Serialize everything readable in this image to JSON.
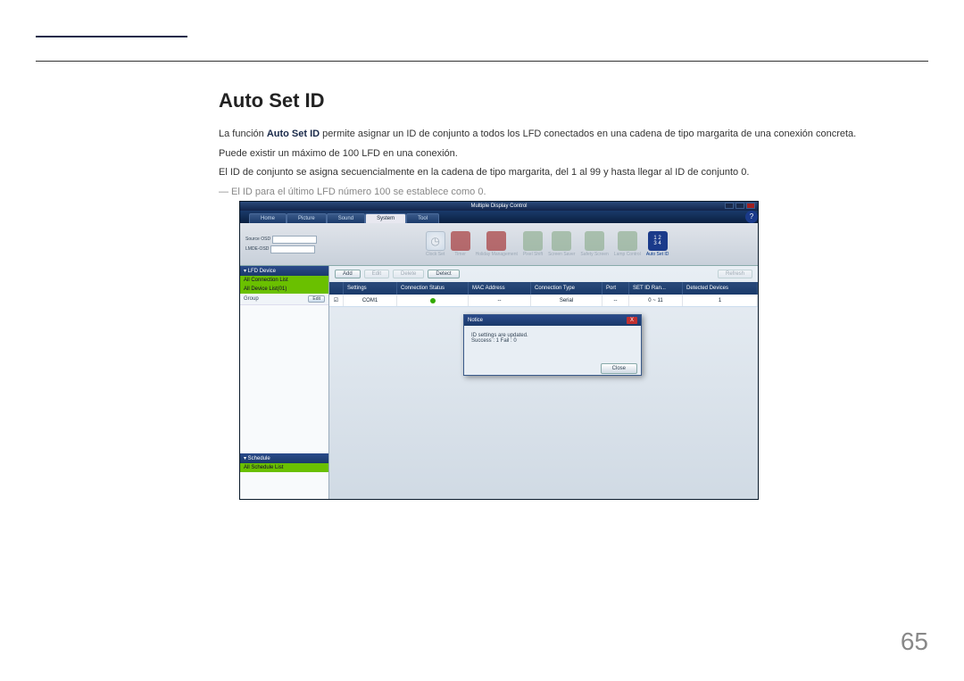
{
  "heading": "Auto Set ID",
  "para1_prefix": "La función ",
  "para1_bold": "Auto Set ID",
  "para1_suffix": " permite asignar un ID de conjunto a todos los LFD conectados en una cadena de tipo margarita de una conexión concreta.",
  "para2": "Puede existir un máximo de 100 LFD en una conexión.",
  "para3": "El ID de conjunto se asigna secuencialmente en la cadena de tipo margarita, del 1 al 99 y hasta llegar al ID de conjunto 0.",
  "note": "El ID para el último LFD número 100 se establece como 0.",
  "page_number": "65",
  "app": {
    "title": "Multiple Display Control",
    "tabs": [
      "Home",
      "Picture",
      "Sound",
      "System",
      "Tool"
    ],
    "active_tab_index": 3,
    "dropdowns": [
      "Source OSD",
      "LMDE-OSD"
    ],
    "tool_icons": [
      {
        "label": "Clock Set",
        "kind": "clock"
      },
      {
        "label": "Timer",
        "kind": "red"
      },
      {
        "label": "Holiday Management",
        "kind": "red"
      },
      {
        "label": "Pixel Shift",
        "kind": "thumb"
      },
      {
        "label": "Screen Saver",
        "kind": "thumb"
      },
      {
        "label": "Safety Screen",
        "kind": "thumb"
      },
      {
        "label": "Lamp Control",
        "kind": "thumb"
      },
      {
        "label": "Auto Set ID",
        "kind": "auto",
        "active": true
      }
    ],
    "sidebar": {
      "lfd_header": "▾ LFD Device",
      "all_conn": "All Connection List",
      "all_dev": "All Device List(01)",
      "group_label": "Group",
      "edit_btn": "Edit",
      "sched_header": "▾ Schedule",
      "all_sched": "All Schedule List"
    },
    "actions": [
      "Add",
      "Edit",
      "Delete",
      "Detect"
    ],
    "refresh": "Refresh",
    "columns": [
      "",
      "Settings",
      "Connection Status",
      "MAC Address",
      "Connection Type",
      "Port",
      "SET ID Ran...",
      "Detected Devices"
    ],
    "row": {
      "settings": "COM1",
      "status": "●",
      "mac": "--",
      "type": "Serial",
      "port": "--",
      "range": "0 ~ 11",
      "detected": "1"
    },
    "dialog": {
      "title": "Notice",
      "line1": "ID settings are updated.",
      "line2": "Success : 1   Fail : 0",
      "close": "Close"
    }
  }
}
